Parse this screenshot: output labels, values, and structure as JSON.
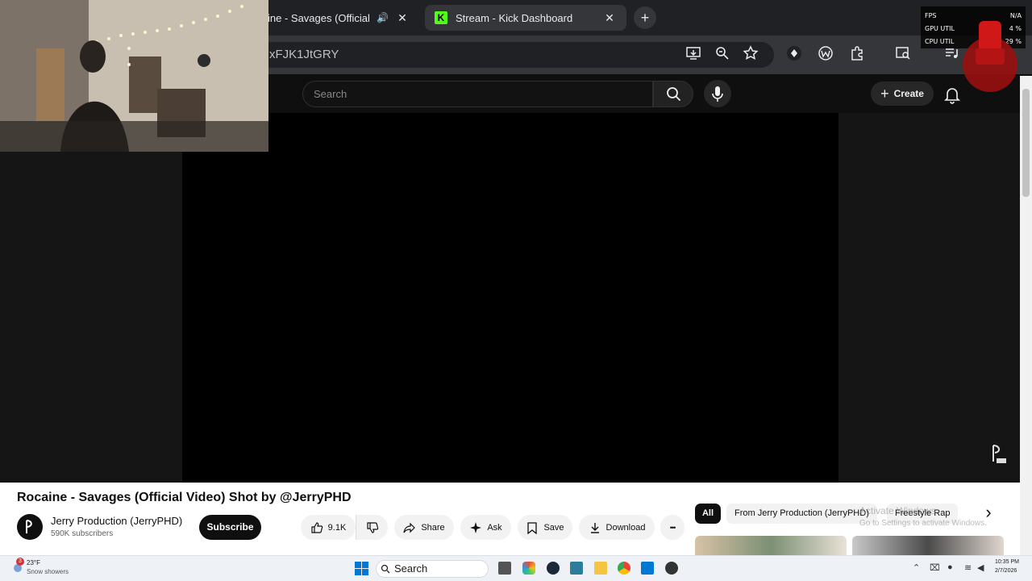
{
  "browser": {
    "tab1_title": "ine - Savages (Official \\",
    "tab2_title": "Stream - Kick Dashboard",
    "tab2_logo": "K",
    "new_tab_icon": "+",
    "url_fragment": "xFJK1JtGRY",
    "close_glyph": "✕",
    "icons": [
      "install-icon",
      "zoom-icon",
      "star-icon",
      "extension-icon",
      "puzzle-icon",
      "lens-icon",
      "media-icon"
    ]
  },
  "overlay_stats": {
    "rows": [
      {
        "label": "FPS",
        "value": "N/A"
      },
      {
        "label": "GPU UTIL",
        "value": "4 %"
      },
      {
        "label": "CPU UTIL",
        "value": "29 %"
      }
    ]
  },
  "youtube": {
    "search_placeholder": "Search",
    "create_label": "Create",
    "video_title": "Rocaine - Savages (Official Video) Shot by @JerryPHD",
    "channel_name": "Jerry Production (JerryPHD)",
    "subscribers": "590K subscribers",
    "subscribe_label": "Subscribe",
    "like_count": "9.1K",
    "share_label": "Share",
    "ask_label": "Ask",
    "save_label": "Save",
    "download_label": "Download",
    "more_glyph": "•••",
    "chips": [
      "All",
      "From Jerry Production (JerryPHD)",
      "Freestyle Rap"
    ],
    "chevron_right": "›"
  },
  "windows": {
    "activate_title": "Activate Windows",
    "activate_sub": "Go to Settings to activate Windows.",
    "weather_temp": "23°F",
    "weather_desc": "Snow showers",
    "weather_badge": "3",
    "taskbar_search": "Search",
    "clock_time": "10:35 PM",
    "clock_date": "2/7/2026"
  },
  "colors": {
    "kick_green": "#53fc18",
    "yt_dark": "#0f0f0f",
    "chrome_dark": "#202124"
  }
}
